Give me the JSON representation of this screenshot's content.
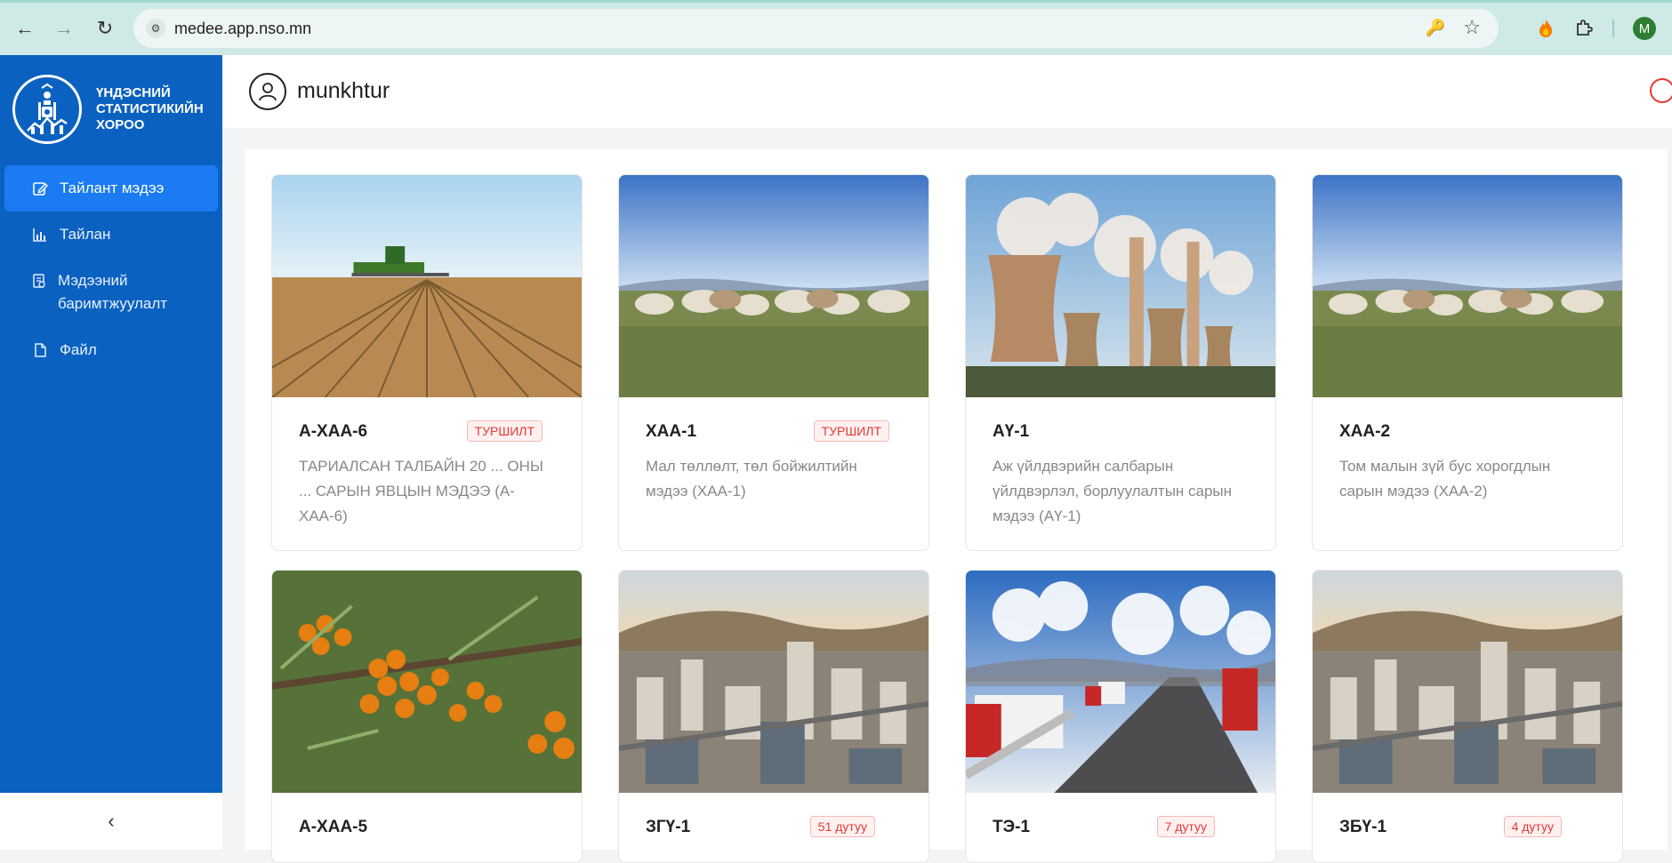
{
  "browser": {
    "url": "medee.app.nso.mn",
    "profile_initial": "M",
    "colors": {
      "bar": "#cfe9e6",
      "profile": "#2e7d32"
    }
  },
  "sidebar": {
    "org_name": "Үндэсний статистикийн хороо",
    "items": [
      {
        "label": "Тайлант мэдээ",
        "icon": "edit-icon",
        "active": true
      },
      {
        "label": "Тайлан",
        "icon": "bar-chart-icon",
        "active": false
      },
      {
        "label": "Мэдээний баримтжуулалт",
        "icon": "document-check-icon",
        "active": false
      },
      {
        "label": "Файл",
        "icon": "file-icon",
        "active": false
      }
    ],
    "collapse_label": "‹",
    "colors": {
      "bg": "#0b61c0",
      "active": "#1a7bf2"
    }
  },
  "header": {
    "username": "munkhtur"
  },
  "cards": [
    {
      "code": "А-ХАА-6",
      "badge": "ТУРШИЛТ",
      "desc": "ТАРИАЛСАН ТАЛБАЙН 20 ... ОНЫ ... САРЫН ЯВЦЫН МЭДЭЭ (А-ХАА-6)",
      "image": "tractor-field"
    },
    {
      "code": "ХАА-1",
      "badge": "ТУРШИЛТ",
      "desc": "Мал төллөлт, төл бойжилтийн мэдээ (ХАА-1)",
      "image": "goats"
    },
    {
      "code": "АҮ-1",
      "badge": "",
      "desc": "Аж үйлдвэрийн салбарын үйлдвэрлэл, борлуулалтын сарын мэдээ (АҮ-1)",
      "image": "power-plant"
    },
    {
      "code": "ХАА-2",
      "badge": "",
      "desc": "Том малын зүй бус хорогдлын сарын мэдээ (ХАА-2)",
      "image": "goats"
    },
    {
      "code": "А-ХАА-5",
      "badge": "",
      "desc": "",
      "image": "sea-buckthorn"
    },
    {
      "code": "ЗГҮ-1",
      "badge": "51 дутуу",
      "desc": "",
      "image": "city"
    },
    {
      "code": "ТЭ-1",
      "badge": "7 дутуу",
      "desc": "",
      "image": "trucks"
    },
    {
      "code": "ЗБҮ-1",
      "badge": "4 дутуу",
      "desc": "",
      "image": "city"
    }
  ]
}
